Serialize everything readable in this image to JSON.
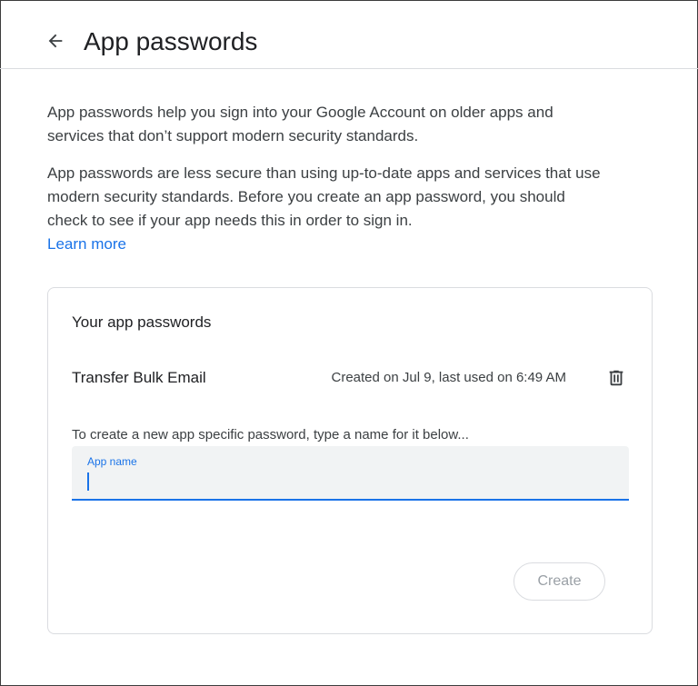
{
  "header": {
    "title": "App passwords",
    "back_icon": "arrow-back-icon"
  },
  "intro": {
    "paragraph1": "App passwords help you sign into your Google Account on older apps and services that don’t support modern security standards.",
    "paragraph2": "App passwords are less secure than using up-to-date apps and services that use modern security standards. Before you create an app password, you should check to see if your app needs this in order to sign in.",
    "learn_more": "Learn more"
  },
  "card": {
    "title": "Your app passwords",
    "passwords": [
      {
        "name": "Transfer Bulk Email",
        "meta": "Created on Jul 9, last used on 6:49 AM",
        "delete_icon": "trash-icon"
      }
    ],
    "hint": "To create a new app specific password, type a name for it below...",
    "field": {
      "label": "App name",
      "value": ""
    },
    "create_label": "Create"
  },
  "colors": {
    "accent": "#1a73e8",
    "text": "#202124",
    "muted": "#3c4043",
    "disabled": "#9aa0a6",
    "border": "#dadce0",
    "field_bg": "#f1f3f4"
  }
}
